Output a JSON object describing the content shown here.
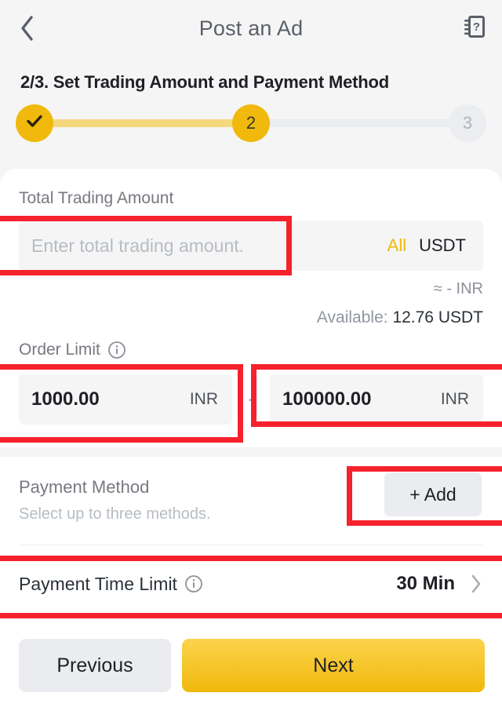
{
  "header": {
    "back_icon": "chevron-left-icon",
    "title": "Post an Ad",
    "help_icon": "help-manual-icon"
  },
  "step": {
    "heading": "2/3. Set Trading Amount and Payment Method",
    "items": [
      {
        "label": "✓",
        "state": "complete"
      },
      {
        "label": "2",
        "state": "active"
      },
      {
        "label": "3",
        "state": "pending"
      }
    ],
    "active_index": 2,
    "total": 3
  },
  "trading_amount": {
    "label": "Total Trading Amount",
    "placeholder": "Enter total trading amount.",
    "value": "",
    "all_label": "All",
    "currency": "USDT",
    "approx": "≈ - INR",
    "available_label": "Available:",
    "available_value": "12.76 USDT"
  },
  "order_limit": {
    "label": "Order Limit",
    "info_icon": "info-circle-icon",
    "min_value": "1000.00",
    "min_currency": "INR",
    "separator": "-",
    "max_value": "100000.00",
    "max_currency": "INR"
  },
  "payment_method": {
    "title": "Payment Method",
    "subtitle": "Select up to three methods.",
    "add_label": "+ Add"
  },
  "payment_time_limit": {
    "label": "Payment Time Limit",
    "info_icon": "info-circle-icon",
    "value": "30 Min",
    "chevron_icon": "chevron-right-icon"
  },
  "footer": {
    "previous_label": "Previous",
    "next_label": "Next"
  },
  "colors": {
    "accent": "#f0b90b",
    "accent_light": "#f5d87e",
    "annotation": "#f5222d",
    "page_bg": "#f5f5f5",
    "card_bg": "#ffffff",
    "field_bg": "#f5f5f5",
    "text_primary": "#1e2026",
    "text_secondary": "#76797f",
    "text_muted": "#b7bcc3",
    "button_neutral": "#eaecef"
  }
}
